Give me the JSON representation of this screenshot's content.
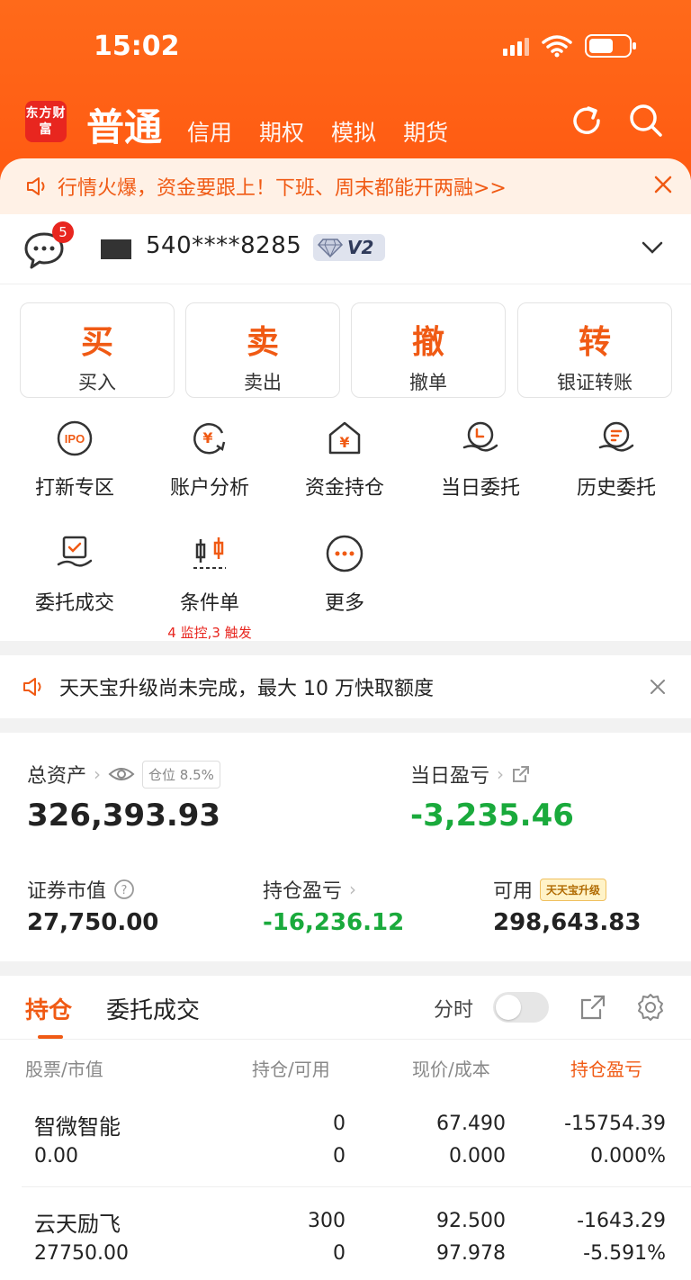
{
  "status": {
    "time": "15:02"
  },
  "header": {
    "logo": "东方财富",
    "active_tab": "普通",
    "tabs": [
      "信用",
      "期权",
      "模拟",
      "期货"
    ]
  },
  "promo_banner": {
    "text": "行情火爆，资金要跟上！下班、周末都能开两融>>"
  },
  "account": {
    "badge": "5",
    "number": "540****8285",
    "level": "V2"
  },
  "trade_buttons": [
    {
      "big": "买",
      "small": "买入"
    },
    {
      "big": "卖",
      "small": "卖出"
    },
    {
      "big": "撤",
      "small": "撤单"
    },
    {
      "big": "转",
      "small": "银证转账"
    }
  ],
  "functions": [
    {
      "label": "打新专区",
      "icon": "ipo-icon"
    },
    {
      "label": "账户分析",
      "icon": "account-analysis-icon"
    },
    {
      "label": "资金持仓",
      "icon": "funds-position-icon"
    },
    {
      "label": "当日委托",
      "icon": "today-order-icon"
    },
    {
      "label": "历史委托",
      "icon": "history-order-icon"
    },
    {
      "label": "委托成交",
      "icon": "order-deal-icon"
    },
    {
      "label": "条件单",
      "icon": "condition-order-icon",
      "sub": "4 监控,3 触发"
    },
    {
      "label": "更多",
      "icon": "more-icon"
    }
  ],
  "notice": {
    "text": "天天宝升级尚未完成，最大 10 万快取额度"
  },
  "assets": {
    "total_label": "总资产",
    "position_chip": "仓位 8.5%",
    "total_value": "326,393.93",
    "day_pl_label": "当日盈亏",
    "day_pl_value": "-3,235.46",
    "market_value_label": "证券市值",
    "market_value": "27,750.00",
    "hold_pl_label": "持仓盈亏",
    "hold_pl_value": "-16,236.12",
    "available_label": "可用",
    "upgrade_tag": "天天宝升级",
    "available_value": "298,643.83"
  },
  "holdings": {
    "tab_active": "持仓",
    "tab_other": "委托成交",
    "fenshi_label": "分时",
    "columns": [
      "股票/市值",
      "持仓/可用",
      "现价/成本",
      "持仓盈亏"
    ],
    "rows": [
      {
        "name": "智微智能",
        "market_value": "0.00",
        "hold": "0",
        "avail": "0",
        "price": "67.490",
        "cost": "0.000",
        "pl": "-15754.39",
        "pl_pct": "0.000%"
      },
      {
        "name": "云天励飞",
        "market_value": "27750.00",
        "hold": "300",
        "avail": "0",
        "price": "92.500",
        "cost": "97.978",
        "pl": "-1643.29",
        "pl_pct": "-5.591%"
      }
    ]
  }
}
